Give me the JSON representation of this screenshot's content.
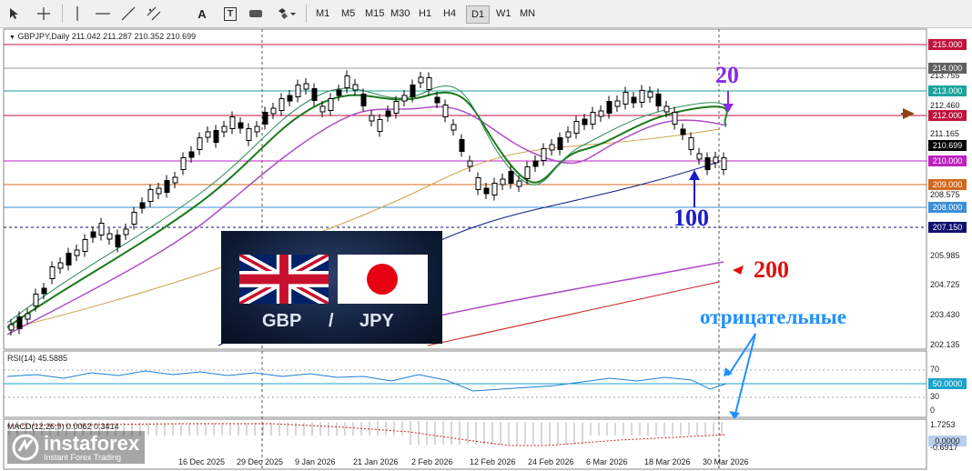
{
  "toolbar": {
    "icons": [
      "cursor-icon",
      "crosshair-icon",
      "vertical-line-icon",
      "horizontal-line-icon",
      "trendline-icon",
      "channel-icon",
      "text-icon",
      "text-label-icon",
      "rectangle-icon",
      "shapes-icon"
    ],
    "text_tool": "A",
    "text_label_tool": "T",
    "timeframes": [
      "M1",
      "M5",
      "M15",
      "M30",
      "H1",
      "H4",
      "D1",
      "W1",
      "MN"
    ],
    "active_timeframe": "D1"
  },
  "chart": {
    "symbol_header": "GBPJPY,Daily  211.042 211.287 210.352 210.699",
    "price_axis": [
      "213.755",
      "212.460",
      "211.165",
      "208.575",
      "205.985",
      "204.725",
      "203.430",
      "202.135"
    ],
    "price_labels": [
      {
        "text": "215.000",
        "color": "#c0143c"
      },
      {
        "text": "214.000",
        "color": "#606060"
      },
      {
        "text": "213.000",
        "color": "#1aa39a"
      },
      {
        "text": "212.000",
        "color": "#c0143c"
      },
      {
        "text": "210.699",
        "color": "#000000"
      },
      {
        "text": "210.000",
        "color": "#c020c0"
      },
      {
        "text": "209.000",
        "color": "#d2691e"
      },
      {
        "text": "208.000",
        "color": "#3a8fd6"
      },
      {
        "text": "207.150",
        "color": "#101070"
      }
    ],
    "date_axis": [
      "16 Dec 2025",
      "29 Dec 2025",
      "9 Jan 2026",
      "21 Jan 2026",
      "2 Feb 2026",
      "12 Feb 2026",
      "24 Feb 2026",
      "6 Mar 2026",
      "18 Mar 2026",
      "30 Mar 2026"
    ],
    "ma_colors": {
      "ma20": "#1a7a1a",
      "ma_fast": "#2e8b57",
      "ma50": "#b04cc8",
      "ma100": "#0c1a80",
      "ma200": "#c81e1e",
      "ma_long": "#cda34c"
    }
  },
  "rsi": {
    "label": "RSI(14) 45.5885",
    "levels": [
      "70",
      "50",
      "30",
      "0"
    ],
    "current_tag": "50.0000"
  },
  "macd": {
    "label": "MACD(12,26,9) 0.0062 0.3414",
    "levels": [
      "1.7253",
      "0.0000",
      "-0.6917"
    ]
  },
  "annotations": {
    "label_20": "20",
    "label_100": "100",
    "label_200": "200",
    "label_negative": "отрицательные",
    "color_20": "#8a2be2",
    "color_100": "#1a1acd",
    "color_200": "#e01010",
    "color_negative": "#1e90ff"
  },
  "overlay": {
    "left_currency": "GBP",
    "separator": "/",
    "right_currency": "JPY"
  },
  "watermark": {
    "brand": "instaforex",
    "tagline": "Instant Forex Trading"
  }
}
